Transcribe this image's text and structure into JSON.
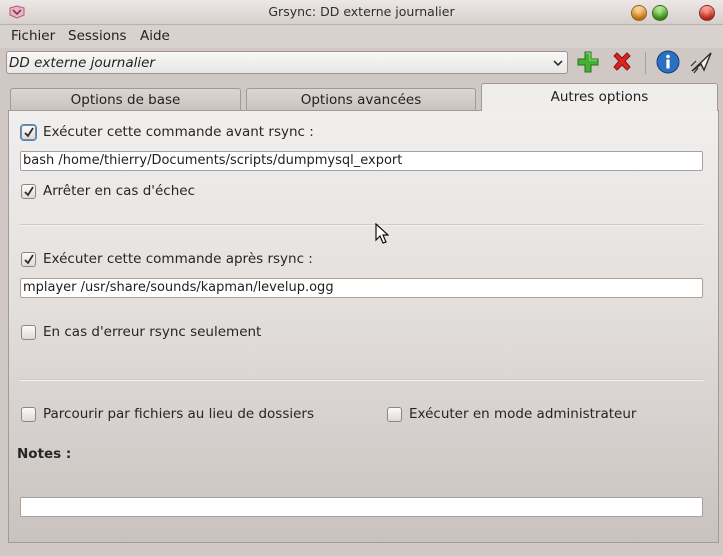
{
  "window": {
    "title": "Grsync: DD externe journalier"
  },
  "menu": {
    "items": [
      {
        "label": "Fichier"
      },
      {
        "label": "Sessions"
      },
      {
        "label": "Aide"
      }
    ]
  },
  "toolbar": {
    "session": "DD externe journalier",
    "icons": [
      "add-icon",
      "delete-icon",
      "info-icon",
      "execute-icon"
    ]
  },
  "tabs": [
    {
      "label": "Options de base",
      "active": false
    },
    {
      "label": "Options avancées",
      "active": false
    },
    {
      "label": "Autres options",
      "active": true
    }
  ],
  "content": {
    "before": {
      "label": "Exécuter cette commande avant rsync :",
      "checked": true,
      "command": "bash /home/thierry/Documents/scripts/dumpmysql_export"
    },
    "stop_on_fail": {
      "label": "Arrêter en cas d'échec",
      "checked": true
    },
    "after": {
      "label": "Exécuter cette commande après rsync :",
      "checked": true,
      "command": "mplayer /usr/share/sounds/kapman/levelup.ogg"
    },
    "on_error_only": {
      "label": "En cas d'erreur rsync seulement",
      "checked": false
    },
    "browse_files": {
      "label": "Parcourir par fichiers au lieu de dossiers",
      "checked": false
    },
    "run_as_admin": {
      "label": "Exécuter en mode administrateur",
      "checked": false
    },
    "notes": {
      "label": "Notes :",
      "value": ""
    }
  },
  "colors": {
    "add": "#3aa52a",
    "delete": "#d92020",
    "info": "#2a6fc0",
    "focus": "#3f87d8"
  }
}
